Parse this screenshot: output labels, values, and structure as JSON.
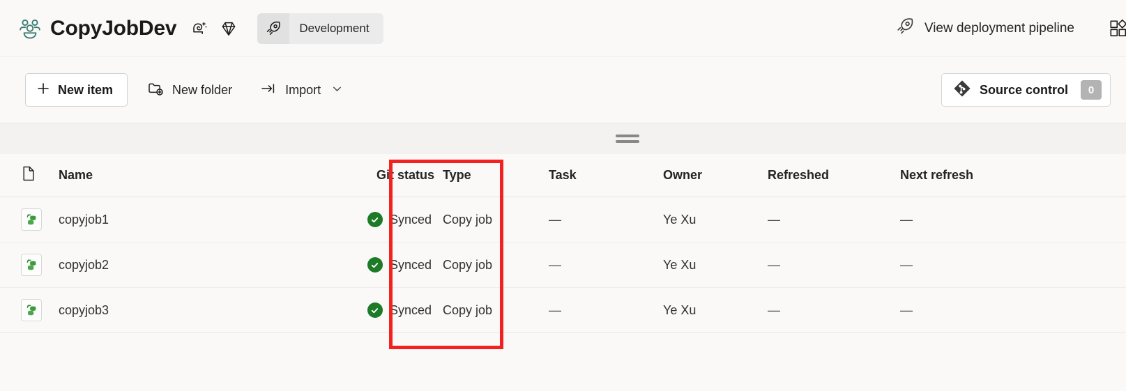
{
  "header": {
    "workspace_icon": "people-group-icon",
    "workspace_title": "CopyJobDev",
    "icons": [
      {
        "name": "ai-sparkle-icon",
        "label": "Copilot"
      },
      {
        "name": "diamond-icon",
        "label": "Premium capacity"
      }
    ],
    "stage_pill": {
      "icon": "rocket-icon",
      "label": "Development"
    },
    "deployment": {
      "icon": "rocket-icon",
      "label": "View deployment pipeline"
    },
    "apps_icon": "apps-grid-add-icon"
  },
  "toolbar": {
    "new_item_label": "New item",
    "new_item_icon": "plus-icon",
    "new_folder_label": "New folder",
    "new_folder_icon": "folder-add-icon",
    "import_label": "Import",
    "import_icon": "import-arrow-icon",
    "import_chevron": "chevron-down-icon",
    "source_control_label": "Source control",
    "source_control_icon": "git-icon",
    "source_control_badge": "0"
  },
  "splitter": {
    "handle_name": "resize-handle"
  },
  "table": {
    "columns": [
      {
        "key": "icon",
        "label": "",
        "icon": "document-icon"
      },
      {
        "key": "name",
        "label": "Name"
      },
      {
        "key": "git_status",
        "label": "Git status"
      },
      {
        "key": "type",
        "label": "Type"
      },
      {
        "key": "task",
        "label": "Task"
      },
      {
        "key": "owner",
        "label": "Owner"
      },
      {
        "key": "refreshed",
        "label": "Refreshed"
      },
      {
        "key": "next_refresh",
        "label": "Next refresh"
      }
    ],
    "rows": [
      {
        "icon": "copy-job-icon",
        "name": "copyjob1",
        "git_status": "Synced",
        "git_status_icon": "check-circle-icon",
        "type": "Copy job",
        "task": "—",
        "owner": "Ye Xu",
        "refreshed": "—",
        "next_refresh": "—"
      },
      {
        "icon": "copy-job-icon",
        "name": "copyjob2",
        "git_status": "Synced",
        "git_status_icon": "check-circle-icon",
        "type": "Copy job",
        "task": "—",
        "owner": "Ye Xu",
        "refreshed": "—",
        "next_refresh": "—"
      },
      {
        "icon": "copy-job-icon",
        "name": "copyjob3",
        "git_status": "Synced",
        "git_status_icon": "check-circle-icon",
        "type": "Copy job",
        "task": "—",
        "owner": "Ye Xu",
        "refreshed": "—",
        "next_refresh": "—"
      }
    ]
  },
  "annotation": {
    "name": "git-status-highlight",
    "color": "#f42121"
  },
  "colors": {
    "page_background": "#faf9f8",
    "synced_green": "#1d7a27",
    "workspace_icon_teal": "#3a7d72",
    "badge_gray": "#b3b3b3",
    "annotation_red": "#f42121"
  }
}
